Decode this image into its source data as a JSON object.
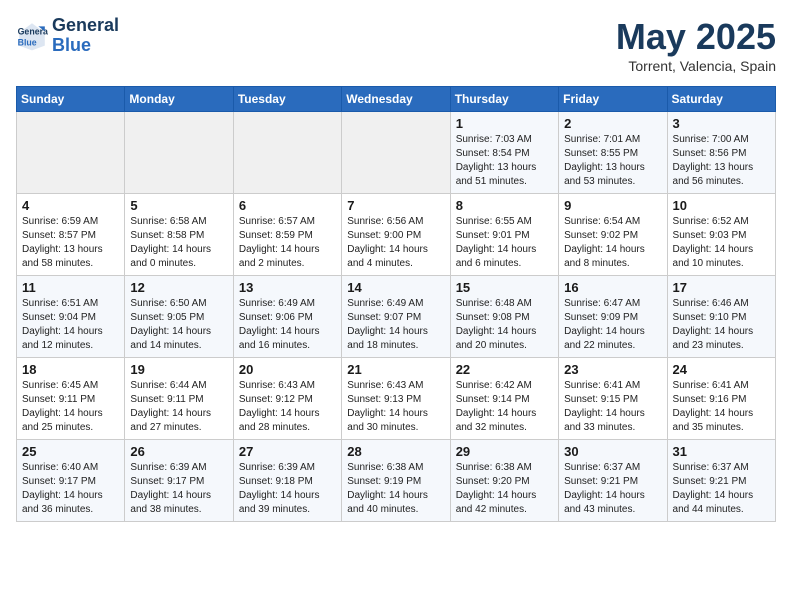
{
  "header": {
    "logo_line1": "General",
    "logo_line2": "Blue",
    "month_year": "May 2025",
    "location": "Torrent, Valencia, Spain"
  },
  "days_of_week": [
    "Sunday",
    "Monday",
    "Tuesday",
    "Wednesday",
    "Thursday",
    "Friday",
    "Saturday"
  ],
  "weeks": [
    [
      {
        "day": "",
        "empty": true
      },
      {
        "day": "",
        "empty": true
      },
      {
        "day": "",
        "empty": true
      },
      {
        "day": "",
        "empty": true
      },
      {
        "day": "1",
        "sunrise": "7:03 AM",
        "sunset": "8:54 PM",
        "daylight": "13 hours and 51 minutes."
      },
      {
        "day": "2",
        "sunrise": "7:01 AM",
        "sunset": "8:55 PM",
        "daylight": "13 hours and 53 minutes."
      },
      {
        "day": "3",
        "sunrise": "7:00 AM",
        "sunset": "8:56 PM",
        "daylight": "13 hours and 56 minutes."
      }
    ],
    [
      {
        "day": "4",
        "sunrise": "6:59 AM",
        "sunset": "8:57 PM",
        "daylight": "13 hours and 58 minutes."
      },
      {
        "day": "5",
        "sunrise": "6:58 AM",
        "sunset": "8:58 PM",
        "daylight": "14 hours and 0 minutes."
      },
      {
        "day": "6",
        "sunrise": "6:57 AM",
        "sunset": "8:59 PM",
        "daylight": "14 hours and 2 minutes."
      },
      {
        "day": "7",
        "sunrise": "6:56 AM",
        "sunset": "9:00 PM",
        "daylight": "14 hours and 4 minutes."
      },
      {
        "day": "8",
        "sunrise": "6:55 AM",
        "sunset": "9:01 PM",
        "daylight": "14 hours and 6 minutes."
      },
      {
        "day": "9",
        "sunrise": "6:54 AM",
        "sunset": "9:02 PM",
        "daylight": "14 hours and 8 minutes."
      },
      {
        "day": "10",
        "sunrise": "6:52 AM",
        "sunset": "9:03 PM",
        "daylight": "14 hours and 10 minutes."
      }
    ],
    [
      {
        "day": "11",
        "sunrise": "6:51 AM",
        "sunset": "9:04 PM",
        "daylight": "14 hours and 12 minutes."
      },
      {
        "day": "12",
        "sunrise": "6:50 AM",
        "sunset": "9:05 PM",
        "daylight": "14 hours and 14 minutes."
      },
      {
        "day": "13",
        "sunrise": "6:49 AM",
        "sunset": "9:06 PM",
        "daylight": "14 hours and 16 minutes."
      },
      {
        "day": "14",
        "sunrise": "6:49 AM",
        "sunset": "9:07 PM",
        "daylight": "14 hours and 18 minutes."
      },
      {
        "day": "15",
        "sunrise": "6:48 AM",
        "sunset": "9:08 PM",
        "daylight": "14 hours and 20 minutes."
      },
      {
        "day": "16",
        "sunrise": "6:47 AM",
        "sunset": "9:09 PM",
        "daylight": "14 hours and 22 minutes."
      },
      {
        "day": "17",
        "sunrise": "6:46 AM",
        "sunset": "9:10 PM",
        "daylight": "14 hours and 23 minutes."
      }
    ],
    [
      {
        "day": "18",
        "sunrise": "6:45 AM",
        "sunset": "9:11 PM",
        "daylight": "14 hours and 25 minutes."
      },
      {
        "day": "19",
        "sunrise": "6:44 AM",
        "sunset": "9:11 PM",
        "daylight": "14 hours and 27 minutes."
      },
      {
        "day": "20",
        "sunrise": "6:43 AM",
        "sunset": "9:12 PM",
        "daylight": "14 hours and 28 minutes."
      },
      {
        "day": "21",
        "sunrise": "6:43 AM",
        "sunset": "9:13 PM",
        "daylight": "14 hours and 30 minutes."
      },
      {
        "day": "22",
        "sunrise": "6:42 AM",
        "sunset": "9:14 PM",
        "daylight": "14 hours and 32 minutes."
      },
      {
        "day": "23",
        "sunrise": "6:41 AM",
        "sunset": "9:15 PM",
        "daylight": "14 hours and 33 minutes."
      },
      {
        "day": "24",
        "sunrise": "6:41 AM",
        "sunset": "9:16 PM",
        "daylight": "14 hours and 35 minutes."
      }
    ],
    [
      {
        "day": "25",
        "sunrise": "6:40 AM",
        "sunset": "9:17 PM",
        "daylight": "14 hours and 36 minutes."
      },
      {
        "day": "26",
        "sunrise": "6:39 AM",
        "sunset": "9:17 PM",
        "daylight": "14 hours and 38 minutes."
      },
      {
        "day": "27",
        "sunrise": "6:39 AM",
        "sunset": "9:18 PM",
        "daylight": "14 hours and 39 minutes."
      },
      {
        "day": "28",
        "sunrise": "6:38 AM",
        "sunset": "9:19 PM",
        "daylight": "14 hours and 40 minutes."
      },
      {
        "day": "29",
        "sunrise": "6:38 AM",
        "sunset": "9:20 PM",
        "daylight": "14 hours and 42 minutes."
      },
      {
        "day": "30",
        "sunrise": "6:37 AM",
        "sunset": "9:21 PM",
        "daylight": "14 hours and 43 minutes."
      },
      {
        "day": "31",
        "sunrise": "6:37 AM",
        "sunset": "9:21 PM",
        "daylight": "14 hours and 44 minutes."
      }
    ]
  ]
}
